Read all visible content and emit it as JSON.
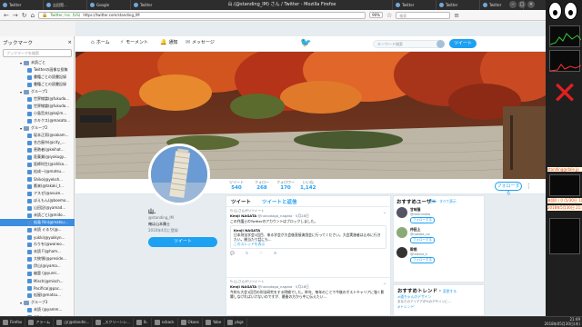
{
  "window": {
    "title": "山.(@standing_lM) さん / Twitter - Mozilla Firefox",
    "desktop_tabs": [
      "Twitter",
      "吉田賢...",
      "Google",
      "Twitter",
      "Twitter",
      "新規",
      "Twitter",
      "ピクエ...",
      "Wi...",
      "Twitter",
      "Twitter",
      "Twitter"
    ]
  },
  "navbar": {
    "site_label": "Twitter, Inc. (US)",
    "url": "https://twitter.com/standing_lM",
    "zoom": "90%",
    "search_placeholder": "検索"
  },
  "sidebar": {
    "title": "ブックマーク",
    "close": "×",
    "search_placeholder": "ブックマークを検索",
    "items": [
      {
        "label": "未読ごと",
        "type": "folder"
      },
      {
        "label": "Twitterの画像な投稿",
        "type": "bookmark"
      },
      {
        "label": "書籍ごとの読書記録",
        "type": "bookmark"
      },
      {
        "label": "書籍ごとの読書記録",
        "type": "bookmark"
      },
      {
        "label": "グループ1",
        "type": "folder"
      },
      {
        "label": "世界線論(@fukuda...",
        "type": "bookmark"
      },
      {
        "label": "世界線論(@fukuda...",
        "type": "bookmark"
      },
      {
        "label": "小島哲夫(@kojim...",
        "type": "bookmark"
      },
      {
        "label": "ホキクス(@masato...",
        "type": "bookmark"
      },
      {
        "label": "グループ2",
        "type": "folder"
      },
      {
        "label": "坂本正男(@sakam...",
        "type": "bookmark"
      },
      {
        "label": "名古屋市(@city_...",
        "type": "bookmark"
      },
      {
        "label": "恵熱者(@keihat...",
        "type": "bookmark"
      },
      {
        "label": "医薬業(@iyakugy...",
        "type": "bookmark"
      },
      {
        "label": "医師科生(@ishika...",
        "type": "bookmark"
      },
      {
        "label": "松成一(@matsu...",
        "type": "bookmark"
      },
      {
        "label": "Shiko(@yeksh...",
        "type": "bookmark"
      },
      {
        "label": "鷹来(@takaki_t...",
        "type": "bookmark"
      },
      {
        "label": "アスゼ(@asuze...",
        "type": "bookmark"
      },
      {
        "label": "ぼえもん(@boemo...",
        "type": "bookmark"
      },
      {
        "label": "山田記(@yamad...",
        "type": "bookmark"
      },
      {
        "label": "未読ごと(@mido...",
        "type": "bookmark"
      },
      {
        "label": "松島 Rin(@matsu...",
        "type": "bookmark",
        "selected": true
      },
      {
        "label": "未読 ぐるり(@...",
        "type": "bookmark"
      },
      {
        "label": "yukki(@yukkyn...",
        "type": "bookmark"
      },
      {
        "label": "わりを(@warwo...",
        "type": "bookmark"
      },
      {
        "label": "未読 F(@ham...",
        "type": "bookmark"
      },
      {
        "label": "大統領(@preside...",
        "type": "bookmark"
      },
      {
        "label": "伊山(@iyama...",
        "type": "bookmark"
      },
      {
        "label": "幽霊 (@yurei...",
        "type": "bookmark"
      },
      {
        "label": "Misch(@misch...",
        "type": "bookmark"
      },
      {
        "label": "Pacifica(@pac...",
        "type": "bookmark"
      },
      {
        "label": "松屋(@matsu...",
        "type": "bookmark"
      },
      {
        "label": "グループ3",
        "type": "folder"
      },
      {
        "label": "未読 (@yamm...",
        "type": "bookmark"
      },
      {
        "label": "CJP(@cjp...",
        "type": "bookmark"
      }
    ]
  },
  "twitter": {
    "nav": [
      "ホーム",
      "モーメント",
      "通知",
      "メッセージ"
    ],
    "search_placeholder": "キーワード検索",
    "tweet_button": "ツイート",
    "stats": [
      {
        "label": "ツイート",
        "value": "540"
      },
      {
        "label": "フォロー",
        "value": "268"
      },
      {
        "label": "フォロワー",
        "value": "170"
      },
      {
        "label": "いいね",
        "value": "1,142"
      }
    ],
    "follow_button": "フォローする",
    "profile": {
      "name": "山.",
      "handle": "@standing_lM",
      "bio": "俺は山本陳士",
      "joined": "2010年4月に登録"
    },
    "tabs": [
      "ツイート",
      "ツイートと返信"
    ],
    "tweets": [
      {
        "retweet_note": "さんがリツイート",
        "author": "Kenji NAGATA",
        "handle": "@nanodaga_nagata · 5月28日",
        "body": "この弁護士のTwitterのアカウントはブロックしました。",
        "quote_author": "Kenji NAGATA",
        "quote_body": "日本刑法学会1回目、来る学会が大会後直接演説会に行ってください。大会実施者は止めに行きたい。総当たり話にも...",
        "quote_more": "このスレッドを表示"
      },
      {
        "retweet_note": "さんがリツイート",
        "author": "Kenji NAGATA",
        "handle": "@nanodaga_nagata · 5月28日",
        "body": "今的も大会1回目の刑法研究をする明細でした。昨年、毎年のことで今後のポストキャリアに強く影響しなければいけないのですが、最後の方から中に伝えたい…"
      }
    ],
    "who_to_follow": {
      "title": "おすすめユーザー",
      "links": "更新 · すべて表示",
      "users": [
        {
          "name": "甘味猫",
          "handle": "@mmmneko",
          "follow": "フォローする"
        },
        {
          "name": "仲田上",
          "handle": "@nakata_ue",
          "follow": "フォローする"
        },
        {
          "name": "幹根",
          "handle": "@mikine_k",
          "follow": "フォローする"
        }
      ]
    },
    "trends": {
      "title": "おすすめトレンド",
      "change": "変更する",
      "items": [
        {
          "tag": "#通ちゃんのデザイン",
          "desc": "あなたのアイデアが%のデザインに…"
        },
        {
          "tag": "#トレンド",
          "desc": "…"
        }
      ]
    }
  },
  "taskbar": {
    "items": [
      "Firefox",
      "アラーム",
      "山(@standin...",
      "_スクリーンシ...",
      "Ik.",
      "scback",
      "Okaes",
      "Yabe",
      "pkgs"
    ],
    "clock_time": "21:49",
    "clock_date": "2018年05月30日(木)"
  },
  "desktop_widgets": {
    "status_text1": "standing@dale.jp",
    "status_text2": "未読0 | 0 (5/30日 10:5...)",
    "status_text3": "2018年5月30日 21:49"
  }
}
